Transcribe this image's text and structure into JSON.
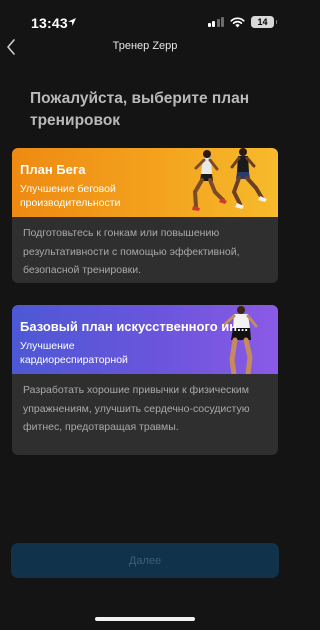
{
  "status_bar": {
    "time": "13:43",
    "battery": "14"
  },
  "nav": {
    "title": "Тренер Zepp"
  },
  "heading": "Пожалуйста, выберите план тренировок",
  "plans": [
    {
      "title": "План Бега",
      "subtitle": "Улучшение беговой производительности",
      "description": "Подготовьтесь к гонкам или повышению результативности с помощью эффективной, безопасной тренировки.",
      "accent": "#f39a1a",
      "image_icon": "runners-image"
    },
    {
      "title": "Базовый план искусственного ин...",
      "subtitle": "Улучшение кардиореспираторной",
      "description": "Разработать хорошие привычки к физическим упражнениям, улучшить сердечно-сосудистую фитнес, предотвращая травмы.",
      "accent": "#6a55dc",
      "image_icon": "athlete-image"
    }
  ],
  "footer": {
    "next_label": "Далее"
  },
  "colors": {
    "background": "#141414",
    "card": "#2f2f2f",
    "button": "#10324a"
  }
}
